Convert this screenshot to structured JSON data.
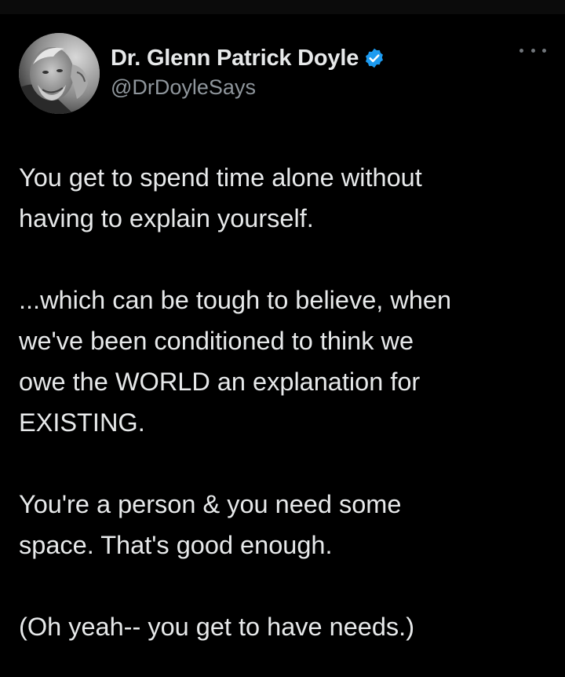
{
  "author": {
    "display_name": "Dr. Glenn Patrick Doyle",
    "handle": "@DrDoyleSays",
    "verified": true,
    "avatar_icon": "profile-photo"
  },
  "actions": {
    "more_icon": "more-horizontal-icon"
  },
  "tweet": {
    "paragraphs": [
      "You get to spend time alone without\nhaving to explain yourself.",
      "...which can be tough to believe, when\nwe've been conditioned to think we\nowe the WORLD an explanation for\nEXISTING.",
      "You're a person & you need some\nspace. That's good enough.",
      "(Oh yeah-- you get to have needs.)"
    ]
  },
  "colors": {
    "background": "#000000",
    "text": "#e7e9ea",
    "secondary_text": "#8f969c",
    "verified_blue": "#1d9bf0"
  }
}
